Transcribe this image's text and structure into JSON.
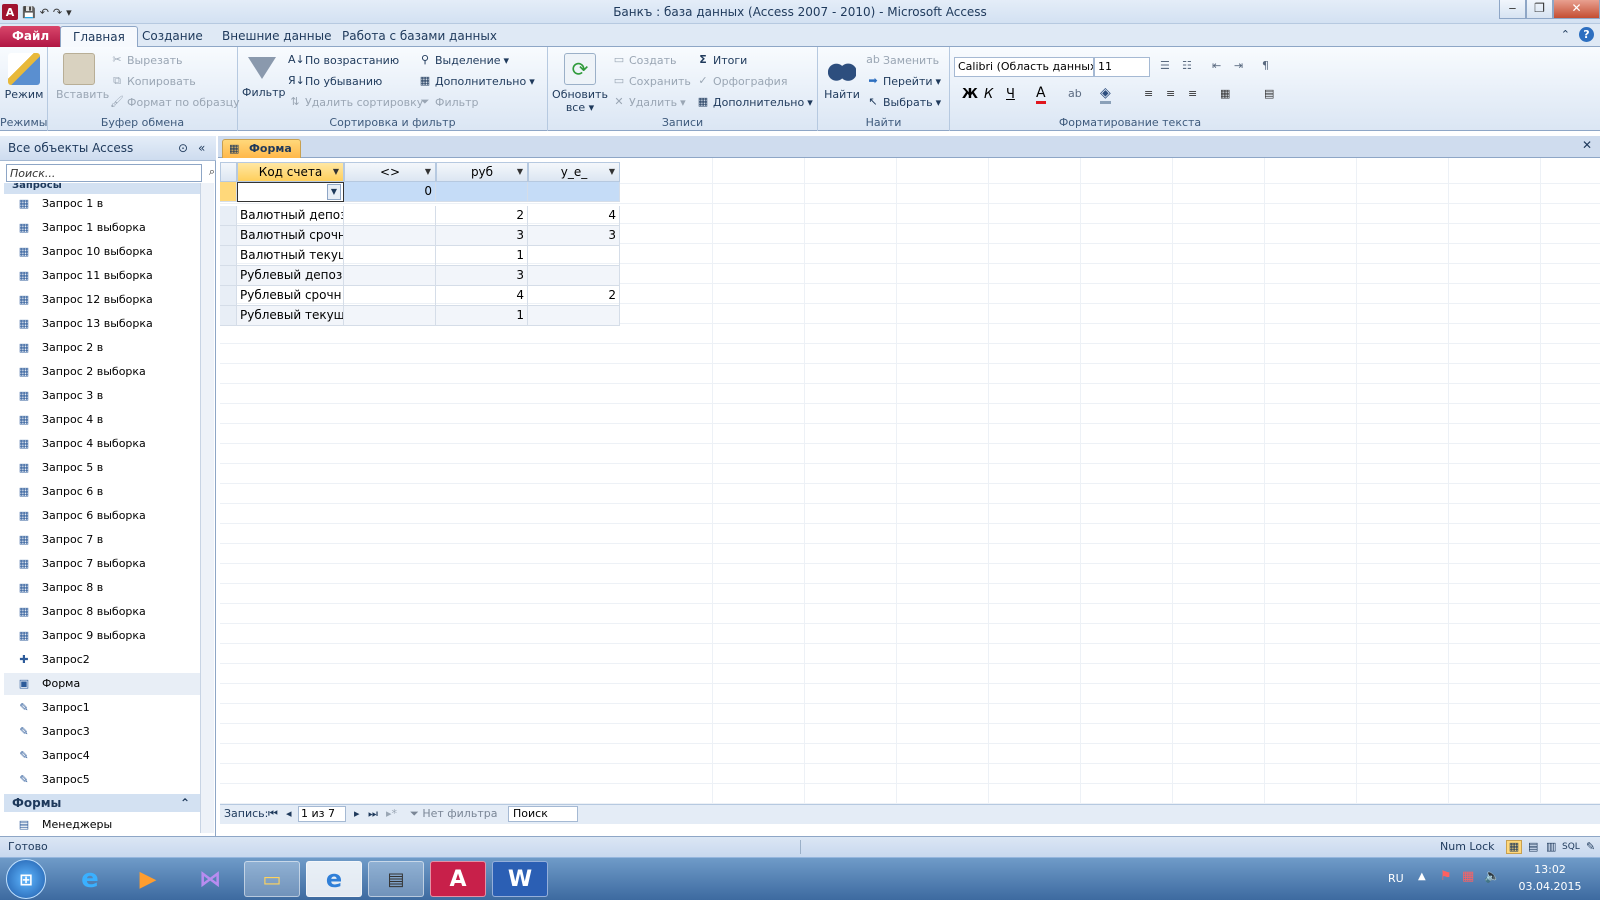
{
  "window": {
    "title": "Банкъ : база данных (Access 2007 - 2010)  -  Microsoft Access"
  },
  "ribbon_tabs": [
    "Файл",
    "Главная",
    "Создание",
    "Внешние данные",
    "Работа с базами данных"
  ],
  "ribbon": {
    "modes": {
      "mode_label": "Режим",
      "group_label": "Режимы"
    },
    "clipboard": {
      "paste": "Вставить",
      "cut": "Вырезать",
      "copy": "Копировать",
      "format_painter": "Формат по образцу",
      "group_label": "Буфер обмена"
    },
    "sort_filter": {
      "filter": "Фильтр",
      "ascending": "По возрастанию",
      "descending": "По убыванию",
      "remove_sort": "Удалить сортировку",
      "selection": "Выделение",
      "advanced": "Дополнительно",
      "toggle_filter": "Фильтр",
      "group_label": "Сортировка и фильтр"
    },
    "records": {
      "refresh_all": "Обновить все",
      "new": "Создать",
      "save": "Сохранить",
      "delete": "Удалить",
      "totals": "Итоги",
      "spelling": "Орфография",
      "more": "Дополнительно",
      "group_label": "Записи"
    },
    "find": {
      "find": "Найти",
      "replace": "Заменить",
      "goto": "Перейти",
      "select": "Выбрать",
      "group_label": "Найти"
    },
    "text_format": {
      "font": "Calibri (Область данных)",
      "font_size": "11",
      "bold": "Ж",
      "italic": "К",
      "underline": "Ч",
      "group_label": "Форматирование текста"
    }
  },
  "nav": {
    "header": "Все объекты Access",
    "search_placeholder": "Поиск...",
    "group_queries": "Запросы",
    "items": [
      {
        "label": "Запрос 1 в",
        "icon": "crosstab-query-icon"
      },
      {
        "label": "Запрос 1 выборка",
        "icon": "crosstab-query-icon"
      },
      {
        "label": "Запрос 10 выборка",
        "icon": "crosstab-query-icon"
      },
      {
        "label": "Запрос 11 выборка",
        "icon": "crosstab-query-icon"
      },
      {
        "label": "Запрос 12 выборка",
        "icon": "crosstab-query-icon"
      },
      {
        "label": "Запрос 13 выборка",
        "icon": "crosstab-query-icon"
      },
      {
        "label": "Запрос 2 в",
        "icon": "crosstab-query-icon"
      },
      {
        "label": "Запрос 2 выборка",
        "icon": "crosstab-query-icon"
      },
      {
        "label": "Запрос 3 в",
        "icon": "crosstab-query-icon"
      },
      {
        "label": "Запрос 4 в",
        "icon": "crosstab-query-icon"
      },
      {
        "label": "Запрос 4 выборка",
        "icon": "crosstab-query-icon"
      },
      {
        "label": "Запрос 5 в",
        "icon": "crosstab-query-icon"
      },
      {
        "label": "Запрос 6 в",
        "icon": "crosstab-query-icon"
      },
      {
        "label": "Запрос 6 выборка",
        "icon": "crosstab-query-icon"
      },
      {
        "label": "Запрос 7 в",
        "icon": "crosstab-query-icon"
      },
      {
        "label": "Запрос 7 выборка",
        "icon": "crosstab-query-icon"
      },
      {
        "label": "Запрос 8 в",
        "icon": "crosstab-query-icon"
      },
      {
        "label": "Запрос 8 выборка",
        "icon": "crosstab-query-icon"
      },
      {
        "label": "Запрос 9 выборка",
        "icon": "crosstab-query-icon"
      },
      {
        "label": "Запрос2",
        "icon": "append-query-icon"
      },
      {
        "label": "Форма",
        "icon": "crosstab-form-icon"
      },
      {
        "label": "Запрос1",
        "icon": "update-query-icon"
      },
      {
        "label": "Запрос3",
        "icon": "update-query-icon"
      },
      {
        "label": "Запрос4",
        "icon": "update-query-icon"
      },
      {
        "label": "Запрос5",
        "icon": "update-query-icon"
      }
    ],
    "group_forms": "Формы",
    "forms": [
      {
        "label": "Менеджеры",
        "icon": "form-icon"
      }
    ]
  },
  "doc_tab": "Форма",
  "datasheet": {
    "columns": [
      "Код счета",
      "<>",
      "руб",
      "у_е_"
    ],
    "rows": [
      [
        "",
        "0",
        "",
        ""
      ],
      [
        "Валютный депоз",
        "",
        "2",
        "4"
      ],
      [
        "Валютный срочн",
        "",
        "3",
        "3"
      ],
      [
        "Валютный текущ",
        "",
        "1",
        ""
      ],
      [
        "Рублевый депоз",
        "",
        "3",
        ""
      ],
      [
        "Рублевый срочн",
        "",
        "4",
        "2"
      ],
      [
        "Рублевый текущ",
        "",
        "1",
        ""
      ]
    ]
  },
  "record_nav": {
    "label": "Запись:",
    "position": "1 из 7",
    "filter": "Нет фильтра",
    "search": "Поиск"
  },
  "status": {
    "left": "Готово",
    "numlock": "Num Lock"
  },
  "taskbar": {
    "lang": "RU",
    "time": "13:02",
    "date": "03.04.2015"
  }
}
